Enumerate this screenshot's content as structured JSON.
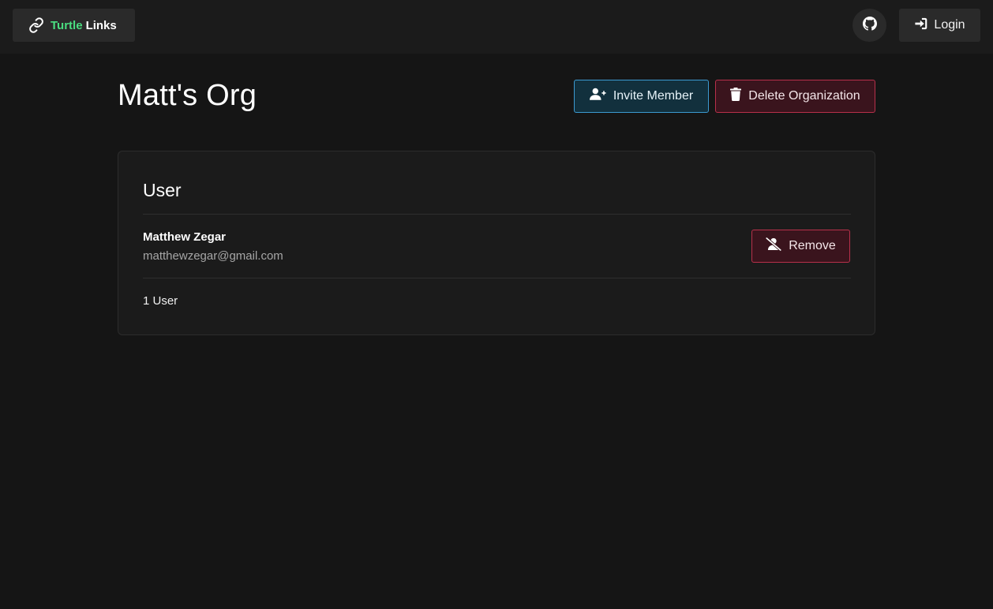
{
  "navbar": {
    "brand": {
      "part1": "Turtle",
      "part2": "Links"
    },
    "github_icon": "github-icon",
    "login_label": "Login",
    "login_icon": "sign-in-icon"
  },
  "org": {
    "title": "Matt's Org",
    "invite_label": "Invite Member",
    "invite_icon": "user-plus-icon",
    "delete_label": "Delete Organization",
    "delete_icon": "trash-icon"
  },
  "members": {
    "heading": "User",
    "items": [
      {
        "name": "Matthew Zegar",
        "email": "matthewzegar@gmail.com",
        "remove_label": "Remove",
        "remove_icon": "user-slash-icon"
      }
    ],
    "count_label": "1 User"
  },
  "colors": {
    "background": "#151515",
    "navbar": "#1b1b1b",
    "brand_green": "#4ade80",
    "info_border": "#3c9ad1",
    "danger_border": "#b8304b"
  }
}
